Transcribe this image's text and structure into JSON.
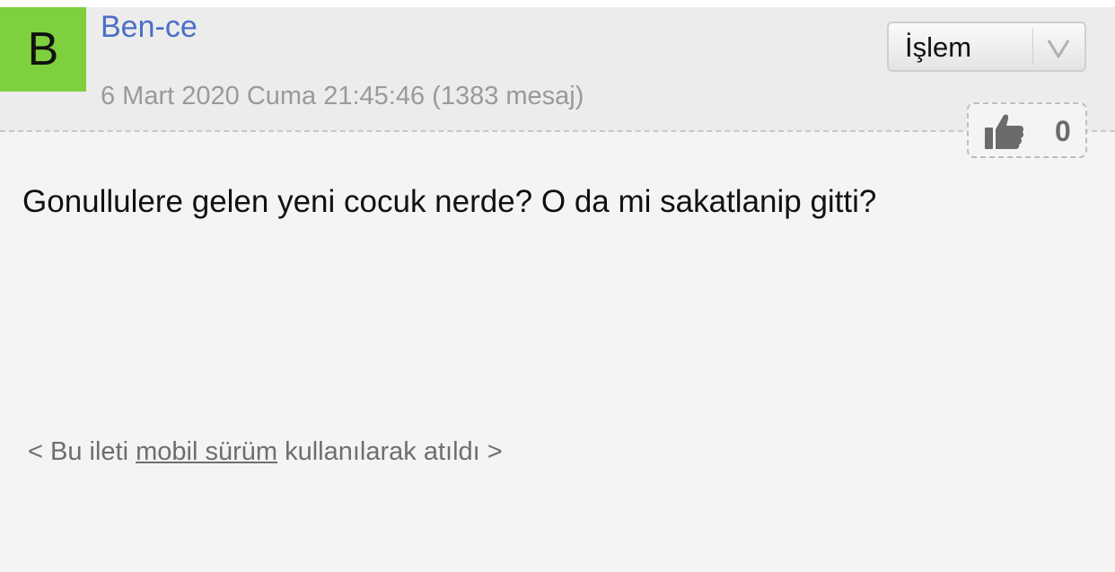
{
  "post": {
    "avatar_letter": "B",
    "author": "Ben-ce",
    "meta": "6 Mart 2020 Cuma 21:45:46 (1383 mesaj)",
    "actions_label": "İşlem",
    "like_count": "0",
    "message": "Gonullulere gelen yeni cocuk nerde? O da mi sakatlanip gitti?",
    "footer": {
      "prefix": "< Bu ileti ",
      "link": "mobil sürüm",
      "suffix": " kullanılarak atıldı >"
    }
  },
  "colors": {
    "avatar_bg": "#7ed03e",
    "author_link": "#4a6fc6",
    "header_bg": "#ececec",
    "page_bg": "#f4f4f4"
  },
  "icons": {
    "dropdown": "chevron-down-icon",
    "like": "thumbs-up-icon"
  }
}
